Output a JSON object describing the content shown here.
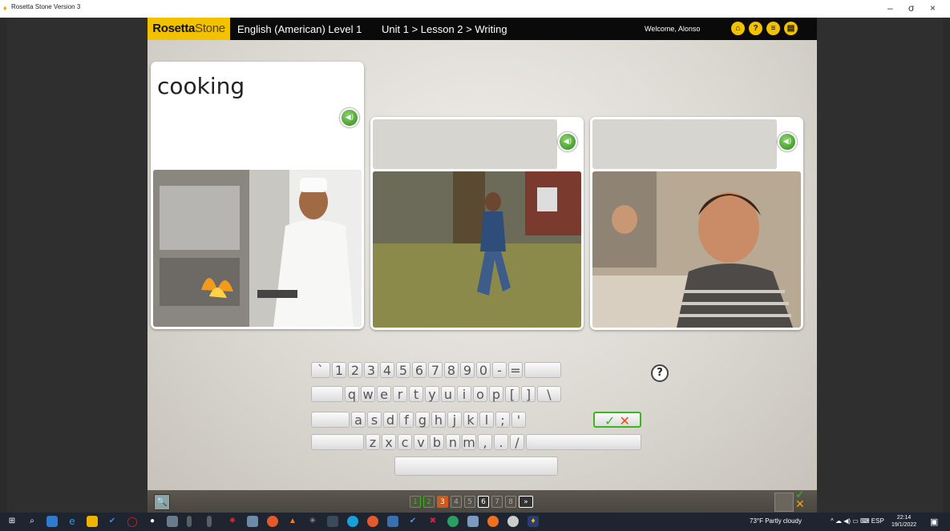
{
  "window": {
    "title": "Rosetta Stone Version 3",
    "min": "–",
    "max": "σ",
    "close": "×"
  },
  "header": {
    "logo_a": "Rosetta",
    "logo_b": "Stone",
    "course": "English (American) Level 1",
    "breadcrumb": "Unit 1 > Lesson 2 > Writing",
    "welcome": "Welcome, Alonso",
    "icons": [
      "home-icon",
      "help-icon",
      "menu-icon",
      "chat-icon"
    ]
  },
  "cards": [
    {
      "word": "cooking",
      "photo": "chef cooking at stove"
    },
    {
      "word": "",
      "photo": "girl running on grass"
    },
    {
      "word": "",
      "photo": "boy smiling at desk"
    }
  ],
  "keyboard": {
    "row1": [
      "`",
      "1",
      "2",
      "3",
      "4",
      "5",
      "6",
      "7",
      "8",
      "9",
      "0",
      "-",
      "="
    ],
    "row2": [
      "q",
      "w",
      "e",
      "r",
      "t",
      "y",
      "u",
      "i",
      "o",
      "p",
      "[",
      "]",
      "\\"
    ],
    "row3": [
      "a",
      "s",
      "d",
      "f",
      "g",
      "h",
      "j",
      "k",
      "l",
      ";",
      "'"
    ],
    "row4": [
      "z",
      "x",
      "c",
      "v",
      "b",
      "n",
      "m",
      ",",
      ".",
      "/"
    ],
    "help": "?",
    "check": "✓",
    "cross": "✕"
  },
  "footer": {
    "pages": [
      "1",
      "2",
      "3",
      "4",
      "5",
      "6",
      "7",
      "8"
    ],
    "current_page": "6",
    "next": "»"
  },
  "taskbar": {
    "weather": "73°F  Partly cloudy",
    "lang": "ESP",
    "time": "22:14",
    "date": "19/1/2022"
  },
  "colors": {
    "brand": "#f2c200",
    "correct": "#3cb521",
    "wrong": "#e74c1b"
  }
}
